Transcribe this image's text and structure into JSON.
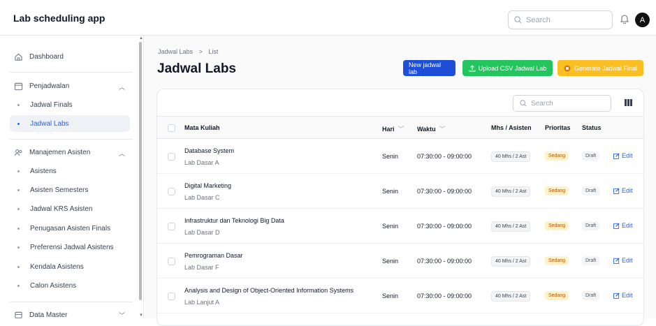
{
  "app": {
    "title": "Lab scheduling app"
  },
  "topbar": {
    "search_placeholder": "Search",
    "avatar_initial": "A"
  },
  "sidebar": {
    "dashboard": "Dashboard",
    "penjadwalan": {
      "label": "Penjadwalan",
      "items": [
        "Jadwal Finals",
        "Jadwal Labs"
      ],
      "active": "Jadwal Labs"
    },
    "manajemen": {
      "label": "Manajemen Asisten",
      "items": [
        "Asistens",
        "Asisten Semesters",
        "Jadwal KRS Asisten",
        "Penugasan Asisten Finals",
        "Preferensi Jadwal Asistens",
        "Kendala Asistens",
        "Calon Asistens"
      ]
    },
    "data_master": "Data Master"
  },
  "page": {
    "breadcrumb": {
      "parent": "Jadwal Labs",
      "separator": ">",
      "current": "List"
    },
    "title": "Jadwal Labs",
    "buttons": {
      "new": "New jadwal lab",
      "upload": "Upload CSV Jadwal Lab",
      "generate": "Generate Jadwal Final"
    },
    "colors": {
      "new": "#1d4ed8",
      "upload": "#22c55e",
      "generate": "#fbbf24"
    }
  },
  "table": {
    "search_placeholder": "Search",
    "headers": {
      "mata_kuliah": "Mata Kuliah",
      "hari": "Hari",
      "waktu": "Waktu",
      "mhs_asisten": "Mhs / Asisten",
      "prioritas": "Prioritas",
      "status": "Status"
    },
    "edit_label": "Edit",
    "rows": [
      {
        "name": "Database System",
        "lab": "Lab Dasar A",
        "hari": "Senin",
        "waktu": "07:30:00 - 09:00:00",
        "mhs": "40 Mhs / 2 Ast",
        "prioritas": "Sedang",
        "status": "Draft"
      },
      {
        "name": "Digital Marketing",
        "lab": "Lab Dasar C",
        "hari": "Senin",
        "waktu": "07:30:00 - 09:00:00",
        "mhs": "40 Mhs / 2 Ast",
        "prioritas": "Sedang",
        "status": "Draft"
      },
      {
        "name": "Infrastruktur dan Teknologi Big Data",
        "lab": "Lab Dasar D",
        "hari": "Senin",
        "waktu": "07:30:00 - 09:00:00",
        "mhs": "40 Mhs / 2 Ast",
        "prioritas": "Sedang",
        "status": "Draft"
      },
      {
        "name": "Pemrograman Dasar",
        "lab": "Lab Dasar F",
        "hari": "Senin",
        "waktu": "07:30:00 - 09:00:00",
        "mhs": "40 Mhs / 2 Ast",
        "prioritas": "Sedang",
        "status": "Draft"
      },
      {
        "name": "Analysis and Design of Object-Oriented Information Systems",
        "lab": "Lab Lanjut A",
        "hari": "Senin",
        "waktu": "07:30:00 - 09:00:00",
        "mhs": "40 Mhs / 2 Ast",
        "prioritas": "Sedang",
        "status": "Draft"
      }
    ]
  }
}
